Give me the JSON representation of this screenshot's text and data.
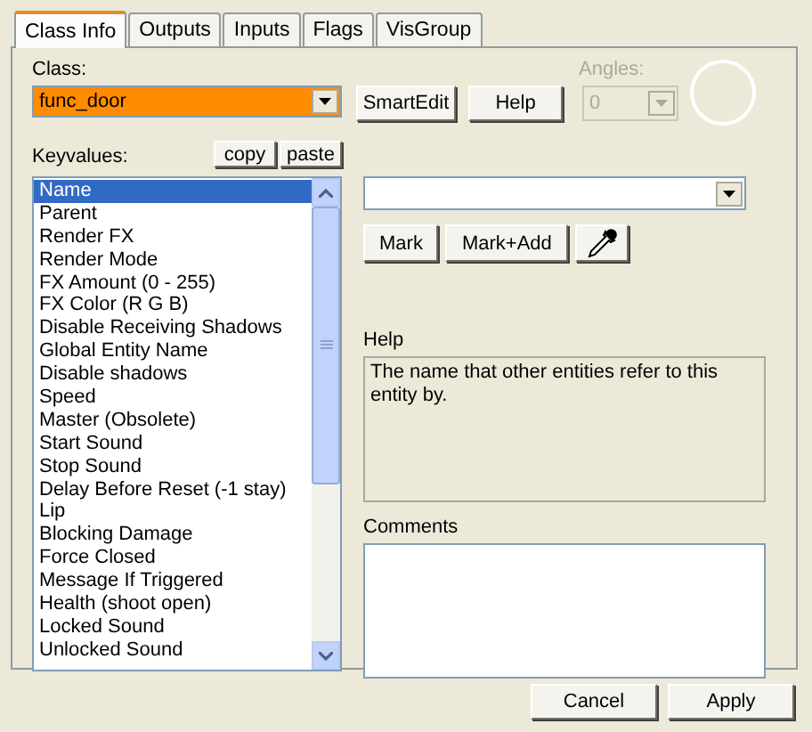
{
  "tabs": [
    {
      "label": "Class Info",
      "selected": true
    },
    {
      "label": "Outputs",
      "selected": false
    },
    {
      "label": "Inputs",
      "selected": false
    },
    {
      "label": "Flags",
      "selected": false
    },
    {
      "label": "VisGroup",
      "selected": false
    }
  ],
  "class": {
    "label": "Class:",
    "value": "func_door"
  },
  "smartedit_button": "SmartEdit",
  "help_button": "Help",
  "angles": {
    "label": "Angles:",
    "value": "0",
    "disabled": true
  },
  "keyvalues": {
    "label": "Keyvalues:",
    "copy": "copy",
    "paste": "paste",
    "items": [
      {
        "label": "Name",
        "selected": true
      },
      {
        "label": "Parent",
        "selected": false
      },
      {
        "label": "Render FX",
        "selected": false
      },
      {
        "label": "Render Mode",
        "selected": false
      },
      {
        "label": "FX Amount (0 - 255)",
        "selected": false
      },
      {
        "label": "FX Color (R G B)",
        "selected": false
      },
      {
        "label": "Disable Receiving Shadows",
        "selected": false
      },
      {
        "label": "Global Entity Name",
        "selected": false
      },
      {
        "label": "Disable shadows",
        "selected": false
      },
      {
        "label": "Speed",
        "selected": false
      },
      {
        "label": "Master (Obsolete)",
        "selected": false
      },
      {
        "label": "Start Sound",
        "selected": false
      },
      {
        "label": "Stop Sound",
        "selected": false
      },
      {
        "label": "Delay Before Reset (-1 stay)",
        "selected": false
      },
      {
        "label": "Lip",
        "selected": false
      },
      {
        "label": "Blocking Damage",
        "selected": false
      },
      {
        "label": "Force Closed",
        "selected": false
      },
      {
        "label": "Message If Triggered",
        "selected": false
      },
      {
        "label": "Health (shoot open)",
        "selected": false
      },
      {
        "label": "Locked Sound",
        "selected": false
      },
      {
        "label": "Unlocked Sound",
        "selected": false
      }
    ]
  },
  "mark_buttons": [
    "Mark",
    "Mark+Add"
  ],
  "help": {
    "label": "Help",
    "text": "The name that other entities refer to this entity by."
  },
  "comments": {
    "label": "Comments"
  },
  "footer_buttons": [
    "Cancel",
    "Apply"
  ]
}
